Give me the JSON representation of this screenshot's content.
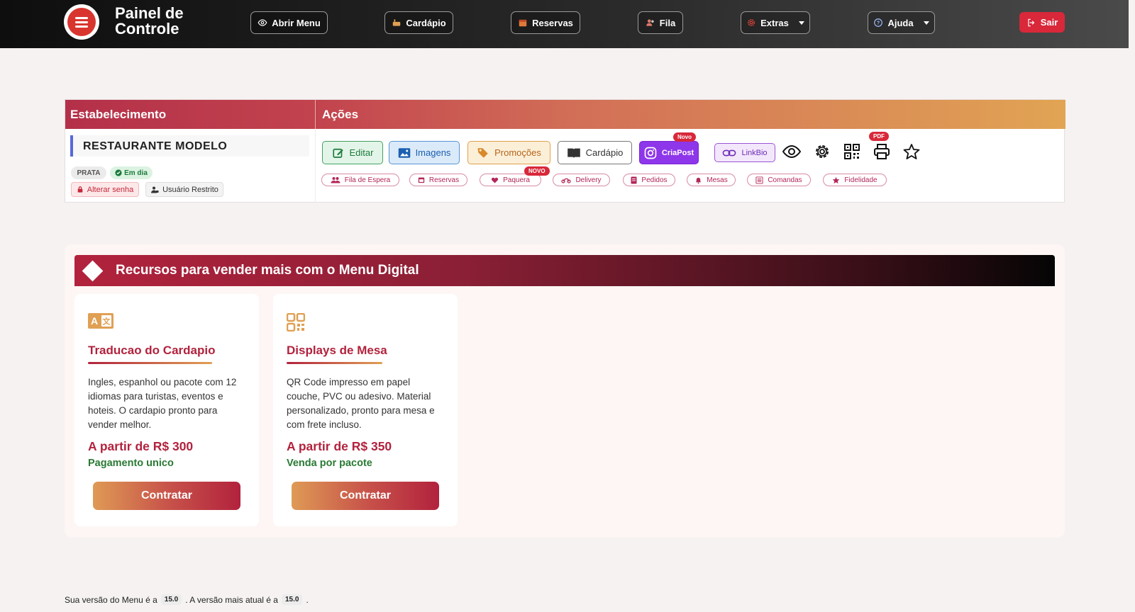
{
  "header": {
    "brand_line1": "Painel de",
    "brand_line2": "Controle",
    "nav": {
      "abrir_menu": "Abrir Menu",
      "cardapio": "Cardápio",
      "reservas": "Reservas",
      "fila": "Fila",
      "extras": "Extras",
      "ajuda": "Ajuda",
      "sair": "Sair"
    }
  },
  "panel": {
    "header_left": "Estabelecimento",
    "header_right": "Ações",
    "establishment_name": "RESTAURANTE MODELO",
    "plan_badge": "PRATA",
    "status_badge": "Em dia",
    "change_password": "Alterar senha",
    "restricted_user": "Usuário Restrito",
    "actions": {
      "editar": "Editar",
      "imagens": "Imagens",
      "promocoes": "Promoções",
      "cardapio": "Cardápio",
      "criapost": "CriaPost",
      "criapost_badge": "Novo",
      "linkbio": "LinkBio",
      "pdf_badge": "PDF"
    },
    "modules": {
      "fila": "Fila de Espera",
      "reservas": "Reservas",
      "paquera": "Paquera",
      "paquera_badge": "NOVO",
      "delivery": "Delivery",
      "pedidos": "Pedidos",
      "mesas": "Mesas",
      "comandas": "Comandas",
      "fidelidade": "Fidelidade"
    }
  },
  "resources": {
    "title": "Recursos para vender mais com o Menu Digital",
    "cards": [
      {
        "title": "Traducao do Cardapio",
        "description": "Ingles, espanhol ou pacote com 12 idiomas para turistas, eventos e hoteis. O cardapio pronto para vender melhor.",
        "price": "A partir de R$ 300",
        "note": "Pagamento unico",
        "button": "Contratar"
      },
      {
        "title": "Displays de Mesa",
        "description": "QR Code impresso em papel couche, PVC ou adesivo. Material personalizado, pronto para mesa e com frete incluso.",
        "price": "A partir de R$ 350",
        "note": "Venda por pacote",
        "button": "Contratar"
      }
    ]
  },
  "footer": {
    "text1": "Sua versão do Menu é a",
    "version_current": "15.0",
    "text2": ". A versão mais atual é a",
    "version_latest": "15.0",
    "text3": "."
  },
  "colors": {
    "accent": "#b2223d",
    "orange": "#e0a054",
    "green": "#2a7a34",
    "purple": "#8e36ea",
    "danger": "#d8283a"
  }
}
